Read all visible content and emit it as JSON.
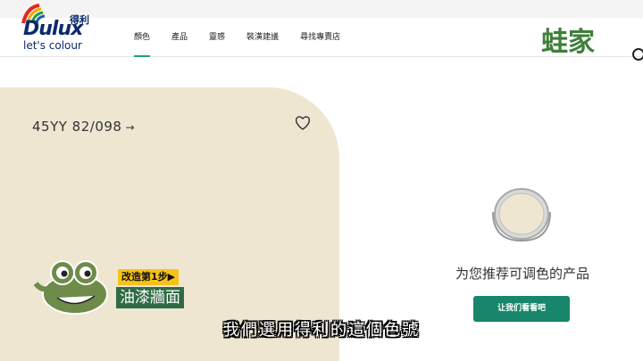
{
  "header": {
    "logo_word": "Dulux",
    "logo_brand": "得利",
    "logo_tagline": "let's colour",
    "nav": [
      {
        "label": "顏色",
        "active": true
      },
      {
        "label": "產品",
        "active": false
      },
      {
        "label": "靈感",
        "active": false
      },
      {
        "label": "裝潢建議",
        "active": false
      },
      {
        "label": "尋找專賣店",
        "active": false
      }
    ]
  },
  "watermark": "蛙家",
  "swatch": {
    "color_code": "45YY 82/098",
    "arrow": "→",
    "swatch_color": "#efe6d1"
  },
  "product_panel": {
    "heading": "为您推荐可调色的产品",
    "cta_label": "让我们看看吧",
    "cta_color": "#17866a"
  },
  "overlay": {
    "step_badge": "改造第1步▶",
    "step_title": "油漆牆面",
    "subtitle": "我們選用得利的這個色號"
  },
  "icons": [
    "rainbow-logo-icon",
    "heart-icon",
    "arrow-right-icon",
    "search-icon",
    "paint-can-icon",
    "frog-mascot-icon"
  ]
}
